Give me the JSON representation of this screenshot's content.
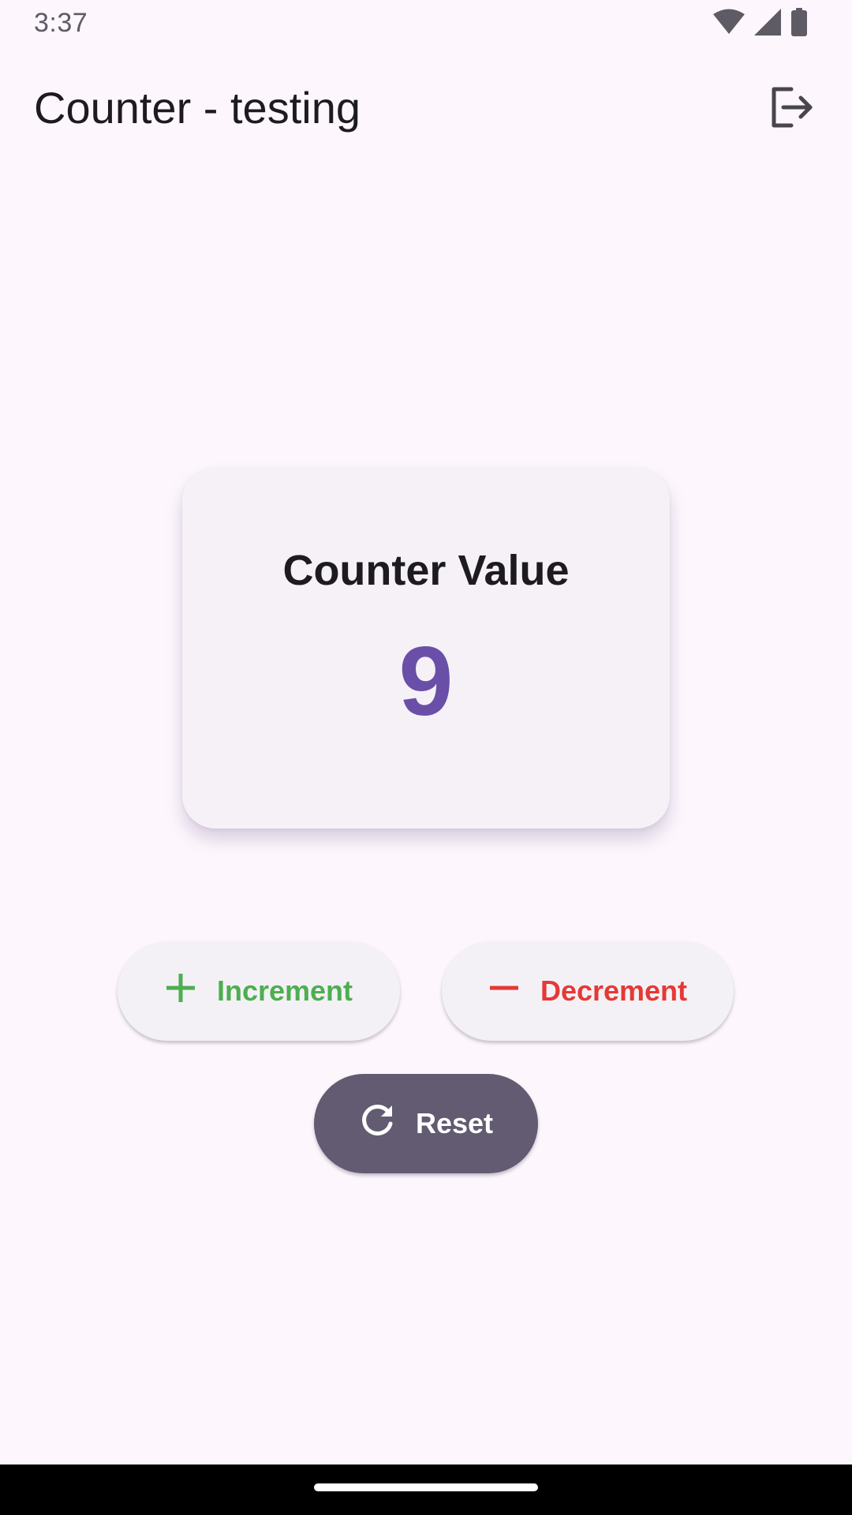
{
  "status_bar": {
    "time": "3:37",
    "icons": [
      "wifi-icon",
      "cellular-signal-icon",
      "battery-icon"
    ]
  },
  "app_bar": {
    "title": "Counter - testing",
    "action_icon": "logout-icon"
  },
  "counter": {
    "label": "Counter Value",
    "value": "9"
  },
  "buttons": {
    "increment": {
      "label": "Increment",
      "icon": "plus-icon",
      "color": "#4caf50"
    },
    "decrement": {
      "label": "Decrement",
      "icon": "minus-icon",
      "color": "#e53935"
    },
    "reset": {
      "label": "Reset",
      "icon": "refresh-icon",
      "color": "#625b71"
    }
  },
  "theme": {
    "background": "#fdf7fd",
    "accent": "#6a4fa8"
  }
}
